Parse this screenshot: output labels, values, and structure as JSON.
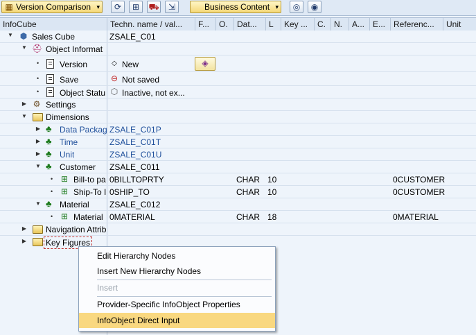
{
  "toolbar": {
    "version_comparison": "Version Comparison",
    "business_content": "Business Content",
    "icons": [
      "refresh-icon",
      "hierarchy-icon",
      "transport-icon",
      "export-icon",
      "binoculars-icon",
      "binoculars-next-icon"
    ]
  },
  "columns": {
    "infocube": "InfoCube",
    "techn_name": "Techn. name / val...",
    "f": "F...",
    "o": "O.",
    "datatype": "Dat...",
    "l": "L",
    "key": "Key ...",
    "c": "C.",
    "n": "N.",
    "a": "A...",
    "e": "E...",
    "reference": "Referenc...",
    "unit": "Unit"
  },
  "tree": {
    "sales_cube": {
      "label": "Sales Cube",
      "tech": "ZSALE_C01"
    },
    "object_information": {
      "label": "Object Informat"
    },
    "version": {
      "label": "Version",
      "value": "New"
    },
    "save": {
      "label": "Save",
      "value": "Not saved"
    },
    "object_status": {
      "label": "Object Statu",
      "value": "Inactive, not ex..."
    },
    "settings": {
      "label": "Settings"
    },
    "dimensions": {
      "label": "Dimensions"
    },
    "data_package": {
      "label": "Data Packag",
      "tech": "ZSALE_C01P"
    },
    "time": {
      "label": "Time",
      "tech": "ZSALE_C01T"
    },
    "unit": {
      "label": "Unit",
      "tech": "ZSALE_C01U"
    },
    "customer": {
      "label": "Customer",
      "tech": "ZSALE_C011"
    },
    "bill_to": {
      "label": "Bill-to pa",
      "tech": "0BILLTOPRTY",
      "datatype": "CHAR",
      "length": "10",
      "reference": "0CUSTOMER"
    },
    "ship_to": {
      "label": "Ship-To I",
      "tech": "0SHIP_TO",
      "datatype": "CHAR",
      "length": "10",
      "reference": "0CUSTOMER"
    },
    "material_dim": {
      "label": "Material",
      "tech": "ZSALE_C012"
    },
    "material": {
      "label": "Material",
      "tech": "0MATERIAL",
      "datatype": "CHAR",
      "length": "18",
      "reference": "0MATERIAL"
    },
    "navigation_attributes": {
      "label": "Navigation Attrib"
    },
    "key_figures": {
      "label": "Key Figures"
    }
  },
  "context_menu": {
    "items": [
      "Edit Hierarchy Nodes",
      "Insert New Hierarchy Nodes",
      "Insert",
      "Provider-Specific InfoObject Properties",
      "InfoObject Direct Input"
    ]
  }
}
